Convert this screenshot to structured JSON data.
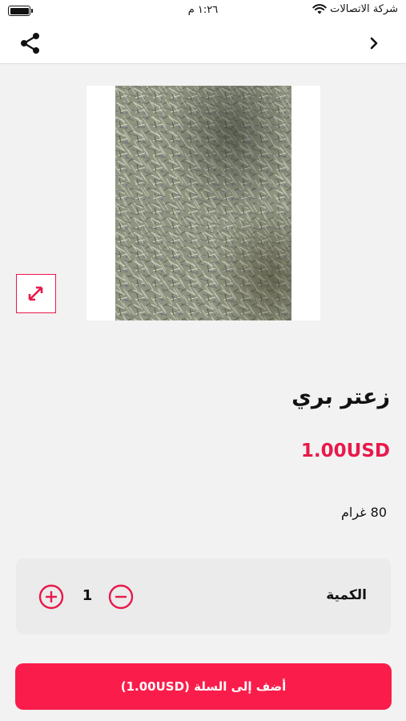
{
  "status_bar": {
    "carrier": "شركة الاتصالات",
    "time": "١:٢٦ م"
  },
  "nav": {
    "back_icon": "chevron-right-icon",
    "share_icon": "share-icon"
  },
  "product": {
    "image_icon": "product-photo",
    "expand_icon": "expand-icon",
    "title": "زعتر بري",
    "price": "1.00USD",
    "weight": "80 غرام"
  },
  "quantity": {
    "label": "الكمية",
    "value": "1"
  },
  "add_to_cart": {
    "label": "أضف إلى السلة (1.00USD)"
  },
  "colors": {
    "accent": "#e8194b",
    "button": "#fa1d4b"
  }
}
